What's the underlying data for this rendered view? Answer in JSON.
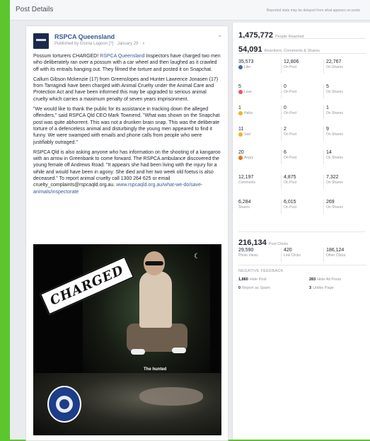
{
  "header": {
    "title": "Post Details",
    "note": "Reported stats may be delayed from what appears on posts"
  },
  "post": {
    "page_name": "RSPCA Queensland",
    "meta": "Published by Emma Lagoon [?] · January 29 · ",
    "paragraphs": [
      [
        "Possum torturers CHARGED! ",
        "RSPCA Queensland",
        " Inspectors have charged two men who deliberately ran over a possum with a car wheel and then laughed as it crawled off with its entrails hanging out. They filmed the torture and posted it on Snapchat."
      ],
      [
        "Callum Gibson Mckenzie (17) from Greenslopes and Hunter Lawrence Jonasen (17) from Tarragindi have been charged with Animal Cruelty under the Animal Care and Protection Act and have been informed this may be upgraded to serious animal cruelty which carries a maximum penalty of seven years imprisonment.",
        "",
        ""
      ],
      [
        "\"We would like to thank the public for its assistance in tracking down the alleged offenders,\" said RSPCA Qld CEO Mark Townend. \"What was shown on the Snapchat post was quite abhorrent. This was not a drunken brain snap. This was the deliberate torture of a defenceless animal and disturbingly the young men appeared to find it funny. We were swamped with emails and phone calls from people who were justifiably outraged.\"",
        "",
        ""
      ],
      [
        "RSPCA Qld is also asking anyone who has information on the shooting of a kangaroo with an arrow in Greenbank to come forward. The RSPCA ambulance discovered the young female off Andrews Road. \"It appears she had been living with the injury for a while and would have been in agony. She died and her two week old foetus is also deceased.\" To report animal cruelty call 1300 264 625 or email cruelty_complaints@rspcaqld.org.au. ",
        "www.rspcaqld.org.au/what-we-do/save-animals/inspectorate",
        ""
      ]
    ],
    "photo_stamp": "CHARGED",
    "photo_caption": "The hunted"
  },
  "stats": {
    "reached": {
      "value": "1,475,772",
      "label": "People Reached"
    },
    "engagement": {
      "value": "54,091",
      "label": "Reactions, Comments & Shares"
    },
    "rows": [
      {
        "icon": "like-icon",
        "color": "#4267b2",
        "cells": [
          {
            "v": "35,573",
            "l": "Like"
          },
          {
            "v": "12,806",
            "l": "On Post"
          },
          {
            "v": "22,767",
            "l": "On Shares"
          }
        ]
      },
      {
        "icon": "love-icon",
        "color": "#f25268",
        "cells": [
          {
            "v": "5",
            "l": "Love"
          },
          {
            "v": "0",
            "l": "On Post"
          },
          {
            "v": "5",
            "l": "On Shares"
          }
        ]
      },
      {
        "icon": "haha-icon",
        "color": "#f7b125",
        "cells": [
          {
            "v": "1",
            "l": "Haha"
          },
          {
            "v": "0",
            "l": "On Post"
          },
          {
            "v": "1",
            "l": "On Shares"
          }
        ]
      },
      {
        "icon": "sad-icon",
        "color": "#f7b125",
        "cells": [
          {
            "v": "11",
            "l": "Sad"
          },
          {
            "v": "2",
            "l": "On Post"
          },
          {
            "v": "9",
            "l": "On Shares"
          }
        ]
      },
      {
        "icon": "angry-icon",
        "color": "#e9710f",
        "cells": [
          {
            "v": "20",
            "l": "Angry"
          },
          {
            "v": "6",
            "l": "On Post"
          },
          {
            "v": "14",
            "l": "On Shares"
          }
        ]
      },
      {
        "icon": "",
        "color": "",
        "cells": [
          {
            "v": "12,197",
            "l": "Comments"
          },
          {
            "v": "4,875",
            "l": "On Post"
          },
          {
            "v": "7,322",
            "l": "On Shares"
          }
        ]
      },
      {
        "icon": "",
        "color": "",
        "cells": [
          {
            "v": "6,284",
            "l": "Shares"
          },
          {
            "v": "6,015",
            "l": "On Post"
          },
          {
            "v": "269",
            "l": "On Shares"
          }
        ]
      }
    ],
    "clicks": {
      "value": "216,134",
      "label": "Post Clicks"
    },
    "click_cells": [
      {
        "v": "29,590",
        "l": "Photo Views"
      },
      {
        "v": "420",
        "l": "Link Clicks"
      },
      {
        "v": "186,124",
        "l": "Other Clicks"
      }
    ],
    "negative": {
      "title": "NEGATIVE FEEDBACK",
      "items": [
        {
          "v": "1,880",
          "l": "Hide Post"
        },
        {
          "v": "283",
          "l": "Hide All Posts"
        },
        {
          "v": "0",
          "l": "Report as Spam"
        },
        {
          "v": "3",
          "l": "Unlike Page"
        }
      ]
    }
  }
}
